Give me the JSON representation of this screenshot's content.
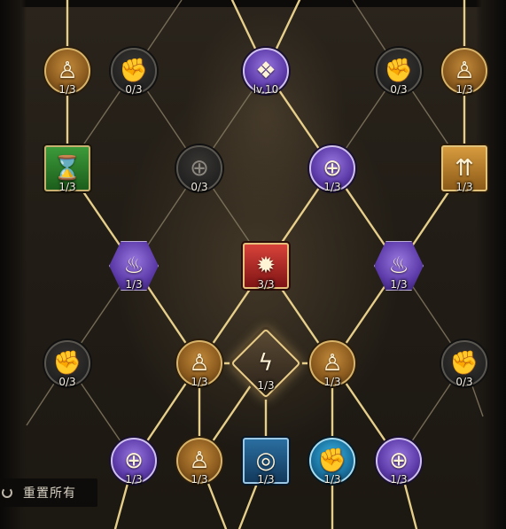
{
  "skill_tree": {
    "nodes": [
      {
        "id": "r1c1",
        "type": "attribute",
        "icon": "humanoid-figure-icon",
        "tier": "gold",
        "shape": "circle",
        "level": "1/3"
      },
      {
        "id": "r1c2",
        "type": "strength",
        "icon": "flexed-arm-icon",
        "tier": "locked",
        "shape": "circle",
        "level": "0/3"
      },
      {
        "id": "r1c3",
        "type": "start",
        "icon": "winged-emblem-icon",
        "tier": "purple",
        "shape": "circle",
        "level": "lv.10"
      },
      {
        "id": "r1c4",
        "type": "strength",
        "icon": "flexed-arm-icon",
        "tier": "locked",
        "shape": "circle",
        "level": "0/3"
      },
      {
        "id": "r1c5",
        "type": "attribute",
        "icon": "humanoid-figure-icon",
        "tier": "gold",
        "shape": "circle",
        "level": "1/3"
      },
      {
        "id": "r2c1",
        "type": "skill",
        "icon": "hourglass-icon",
        "tier": "green",
        "shape": "square",
        "level": "1/3"
      },
      {
        "id": "r2c2",
        "type": "crosshair",
        "icon": "crosshair-icon",
        "tier": "locked",
        "shape": "circle",
        "level": "0/3"
      },
      {
        "id": "r2c3",
        "type": "crosshair",
        "icon": "crosshair-icon",
        "tier": "purple",
        "shape": "circle",
        "level": "1/3"
      },
      {
        "id": "r2c4",
        "type": "skill",
        "icon": "arrows-up-icon",
        "tier": "orange",
        "shape": "square",
        "level": "1/3"
      },
      {
        "id": "r3c1",
        "type": "aura",
        "icon": "burning-figure-icon",
        "tier": "purple",
        "shape": "hex",
        "level": "1/3"
      },
      {
        "id": "r3c2",
        "type": "skill",
        "icon": "demon-mask-icon",
        "tier": "red",
        "shape": "square",
        "level": "3/3"
      },
      {
        "id": "r3c3",
        "type": "aura",
        "icon": "burning-figure-icon",
        "tier": "purple",
        "shape": "hex",
        "level": "1/3"
      },
      {
        "id": "r4c1",
        "type": "strength",
        "icon": "flexed-arm-icon",
        "tier": "locked",
        "shape": "circle",
        "level": "0/3"
      },
      {
        "id": "r4c2",
        "type": "attribute",
        "icon": "humanoid-figure-icon",
        "tier": "gold",
        "shape": "circle",
        "level": "1/3"
      },
      {
        "id": "r4c3",
        "type": "core",
        "icon": "flame-sigil-icon",
        "tier": "core",
        "shape": "diamond",
        "level": "1/3"
      },
      {
        "id": "r4c4",
        "type": "attribute",
        "icon": "humanoid-figure-icon",
        "tier": "gold",
        "shape": "circle",
        "level": "1/3"
      },
      {
        "id": "r4c5",
        "type": "strength",
        "icon": "flexed-arm-icon",
        "tier": "locked",
        "shape": "circle",
        "level": "0/3"
      },
      {
        "id": "r5c1",
        "type": "crosshair",
        "icon": "crosshair-icon",
        "tier": "purple",
        "shape": "circle",
        "level": "1/3"
      },
      {
        "id": "r5c2",
        "type": "attribute",
        "icon": "humanoid-figure-icon",
        "tier": "gold",
        "shape": "circle",
        "level": "1/3"
      },
      {
        "id": "r5c3",
        "type": "skill",
        "icon": "target-icon",
        "tier": "blue",
        "shape": "square",
        "level": "1/3"
      },
      {
        "id": "r5c4",
        "type": "strength",
        "icon": "flexed-arm-icon",
        "tier": "cyan",
        "shape": "circle",
        "level": "1/3"
      },
      {
        "id": "r5c5",
        "type": "crosshair",
        "icon": "crosshair-icon",
        "tier": "purple",
        "shape": "circle",
        "level": "1/3"
      }
    ]
  },
  "reset": {
    "label": "重置所有",
    "icon": "reset-icon"
  },
  "colors": {
    "link_line": "#f0d890",
    "background": "#211c15"
  }
}
